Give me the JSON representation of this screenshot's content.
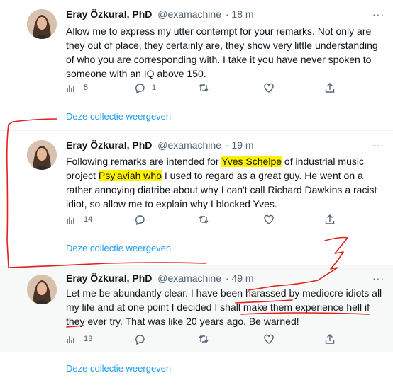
{
  "tweets": [
    {
      "name": "Eray Özkural, PhD",
      "handle": "@examachine",
      "time": "· 18 m",
      "text_parts": [
        "Allow me to express my utter contempt for your remarks. Not only are they out of place, they certainly are, they show very little understanding of who you are corresponding with. I take it you have never spoken to someone with an IQ above 150."
      ],
      "views": "5",
      "replies": "1",
      "collection_link": "Deze collectie weergeven"
    },
    {
      "name": "Eray Özkural, PhD",
      "handle": "@examachine",
      "time": "· 19 m",
      "text_parts": [
        "Following remarks are intended for ",
        "Yves Schelpe",
        " of industrial music project ",
        "Psy'aviah who",
        " I used to regard as a great guy. He went on a rather annoying diatribe about why I can't call Richard Dawkins a racist idiot, so allow me to explain why I blocked Yves."
      ],
      "views": "14",
      "collection_link": "Deze collectie weergeven"
    },
    {
      "name": "Eray Özkural, PhD",
      "handle": "@examachine",
      "time": "· 49 m",
      "text_parts": [
        "Let me be abundantly clear. I have been harassed by mediocre idiots all my life and at one point I decided I shall make them experience hell if they ever try. That was like 20 years ago. Be warned!"
      ],
      "views": "13",
      "collection_link": "Deze collectie weergeven"
    }
  ],
  "more_label": "···",
  "colors": {
    "link": "#1d9bf0",
    "highlight": "#fff200",
    "annotation": "#e0201b",
    "muted": "#536471"
  },
  "icons": [
    "views-icon",
    "reply-icon",
    "retweet-icon",
    "like-icon",
    "share-icon",
    "more-icon"
  ]
}
